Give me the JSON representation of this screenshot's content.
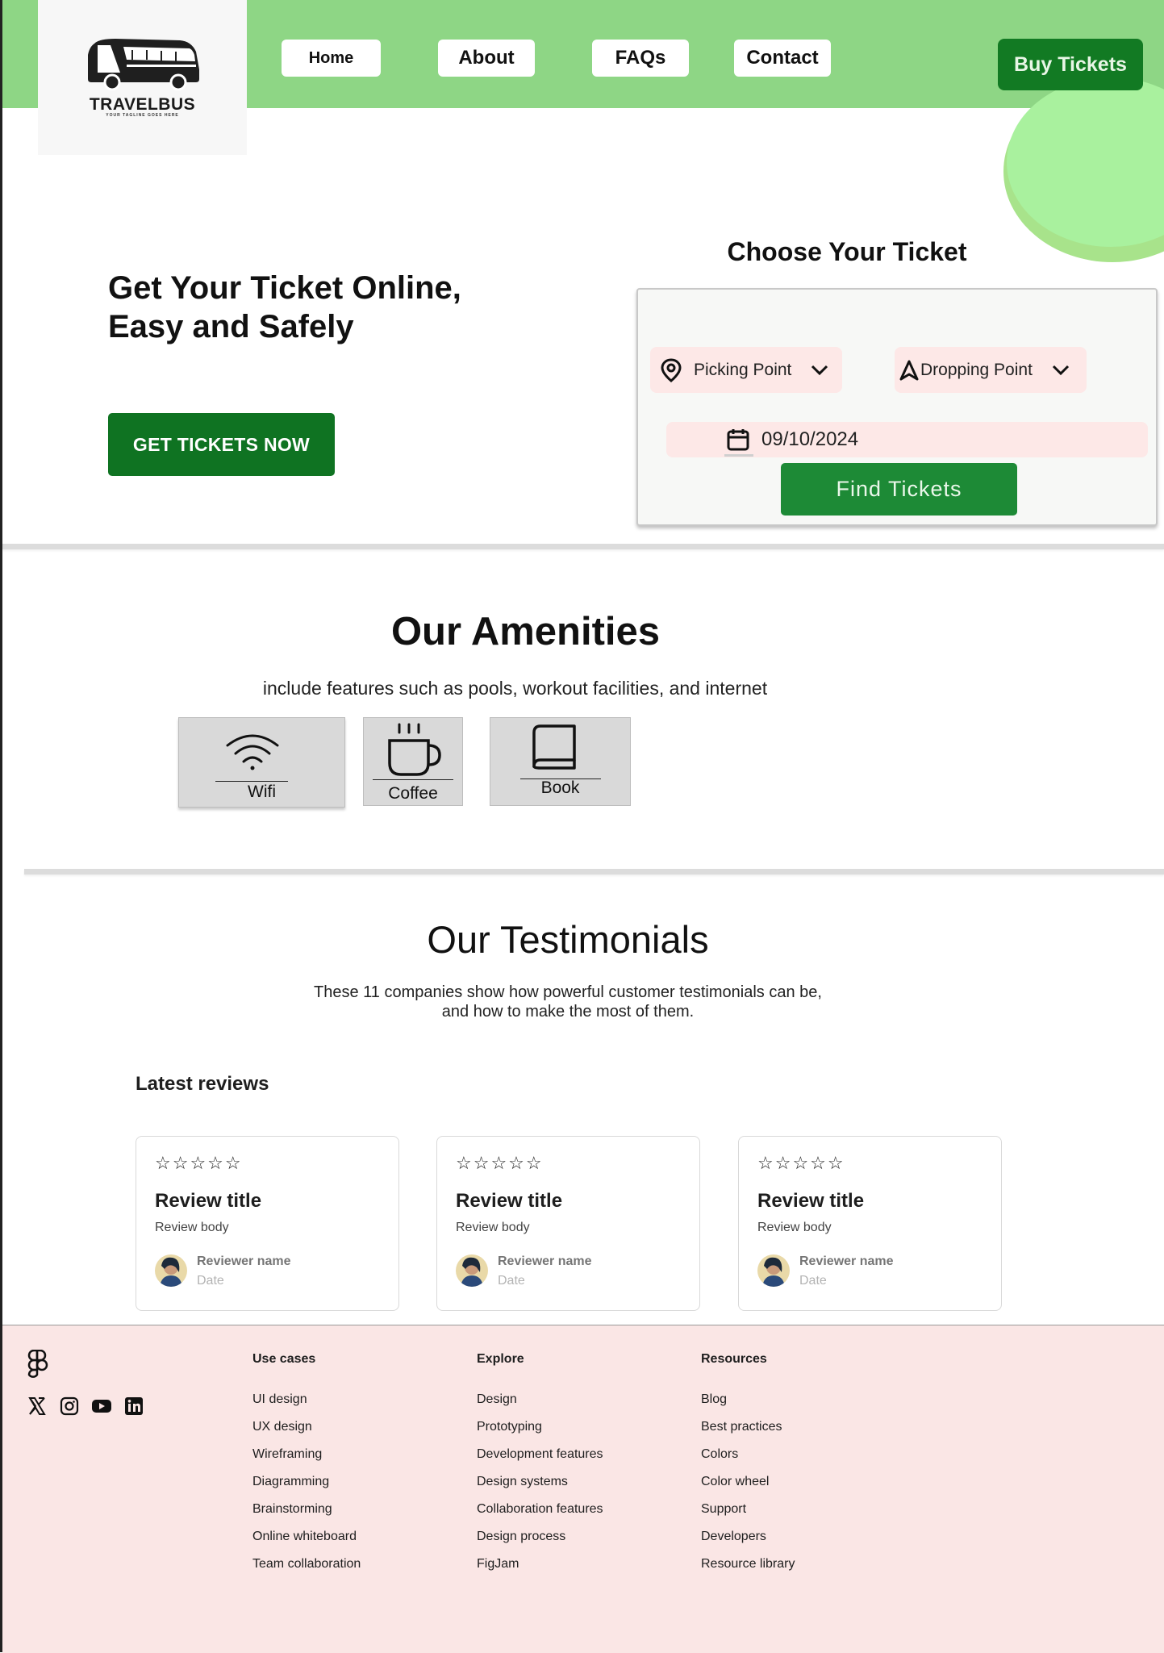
{
  "brand": {
    "name": "TRAVELBUS",
    "tagline": "YOUR TAGLINE GOES HERE"
  },
  "nav": {
    "home": "Home",
    "about": "About",
    "faqs": "FAQs",
    "contact": "Contact",
    "buy_tickets": "Buy Tickets"
  },
  "hero": {
    "title_line1": "Get Your Ticket Online,",
    "title_line2": "Easy and Safely",
    "cta": "GET TICKETS NOW"
  },
  "ticket_form": {
    "title": "Choose Your Ticket",
    "picking_point": "Picking Point",
    "dropping_point": "Dropping Point",
    "date": "09/10/2024",
    "find_button": "Find Tickets"
  },
  "amenities": {
    "title": "Our Amenities",
    "subtitle": "include features such as pools, workout facilities, and internet",
    "items": [
      {
        "label": "Wifi",
        "icon": "wifi-icon"
      },
      {
        "label": "Coffee",
        "icon": "coffee-icon"
      },
      {
        "label": "Book",
        "icon": "book-icon"
      }
    ]
  },
  "testimonials": {
    "title": "Our Testimonials",
    "subtitle_line1": "These 11 companies show how powerful customer testimonials can be,",
    "subtitle_line2": "and how to make the most of them.",
    "latest_label": "Latest reviews",
    "reviews": [
      {
        "stars": "☆☆☆☆☆",
        "title": "Review title",
        "body": "Review body",
        "reviewer": "Reviewer name",
        "date": "Date"
      },
      {
        "stars": "☆☆☆☆☆",
        "title": "Review title",
        "body": "Review body",
        "reviewer": "Reviewer name",
        "date": "Date"
      },
      {
        "stars": "☆☆☆☆☆",
        "title": "Review title",
        "body": "Review body",
        "reviewer": "Reviewer name",
        "date": "Date"
      }
    ]
  },
  "footer": {
    "social_icons": [
      "x-icon",
      "instagram-icon",
      "youtube-icon",
      "linkedin-icon"
    ],
    "columns": [
      {
        "heading": "Use cases",
        "links": [
          "UI design",
          "UX design",
          "Wireframing",
          "Diagramming",
          "Brainstorming",
          "Online whiteboard",
          "Team collaboration"
        ]
      },
      {
        "heading": "Explore",
        "links": [
          "Design",
          "Prototyping",
          "Development features",
          "Design systems",
          "Collaboration features",
          "Design process",
          "FigJam"
        ]
      },
      {
        "heading": "Resources",
        "links": [
          "Blog",
          "Best practices",
          "Colors",
          "Color wheel",
          "Support",
          "Developers",
          "Resource library"
        ]
      }
    ]
  },
  "colors": {
    "header_green": "#8ed685",
    "button_green": "#0f7322",
    "pill_pink": "#fde8e7",
    "footer_pink": "#fae6e5"
  }
}
